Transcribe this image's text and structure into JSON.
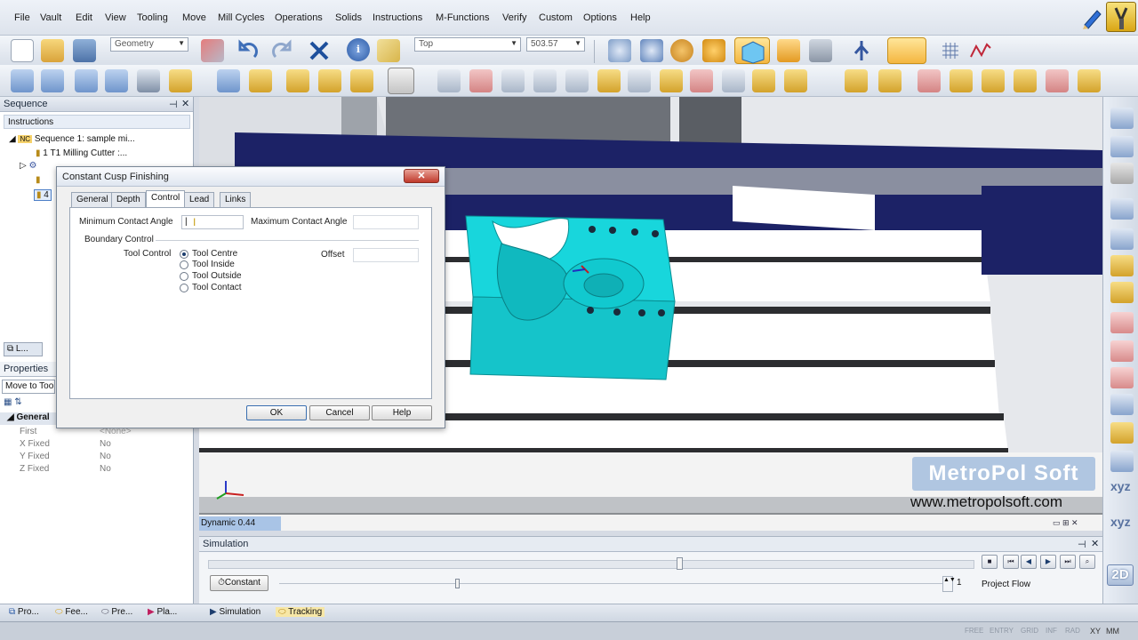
{
  "menu": [
    "File",
    "Vault",
    "Edit",
    "View",
    "Tooling",
    "Move",
    "Mill Cycles",
    "Operations",
    "Solids",
    "Instructions",
    "M-Functions",
    "Verify",
    "Custom",
    "Options",
    "Help"
  ],
  "toolbar": {
    "view_combo": "Geometry",
    "orient_combo": "Top",
    "zoom_value": "503.57"
  },
  "sequence_panel": {
    "title": "Sequence",
    "root": "Instructions",
    "seq_label": "Sequence 1: sample mi...",
    "tool_item": "1 T1 Milling Cutter :...",
    "row3": "4",
    "tabs_label": "L..."
  },
  "properties_panel": {
    "title": "Properties",
    "dropdown": "Move to Too",
    "group": "General",
    "rows": [
      {
        "name": "First",
        "value": "<None>"
      },
      {
        "name": "X Fixed",
        "value": "No"
      },
      {
        "name": "Y Fixed",
        "value": "No"
      },
      {
        "name": "Z Fixed",
        "value": "No"
      }
    ]
  },
  "dialog": {
    "title": "Constant Cusp Finishing",
    "close": "✕",
    "tabs": [
      "General",
      "Depth",
      "Control",
      "Lead",
      "Links"
    ],
    "active_tab": "Control",
    "min_angle_label": "Minimum Contact Angle",
    "max_angle_label": "Maximum Contact Angle",
    "boundary_label": "Boundary Control",
    "tool_control_label": "Tool Control",
    "offset_label": "Offset",
    "radios": [
      "Tool Centre",
      "Tool Inside",
      "Tool Outside",
      "Tool Contact"
    ],
    "selected_radio": "Tool Centre",
    "ok": "OK",
    "cancel": "Cancel",
    "help": "Help"
  },
  "viewport": {
    "status": "Dynamic 0.44",
    "brand": "MetroPol Soft",
    "url": "www.metropolsoft.com"
  },
  "simulation": {
    "title": "Simulation",
    "mode_button": "Constant",
    "step_value": "1",
    "project_flow": "Project Flow",
    "tabs": [
      "Simulation",
      "Tracking"
    ]
  },
  "bottom_tabs": [
    "Pro...",
    "Fee...",
    "Pre...",
    "Pla..."
  ],
  "status": {
    "items": [
      "FREE",
      "ENTRY",
      "GRID",
      "INF",
      "RAD",
      "XY",
      "MM"
    ]
  },
  "rightbar": {
    "xyz1": "xyz",
    "xyz2": "xyz",
    "btn2d": "2D"
  },
  "colors": {
    "part": "#14d6dc",
    "accent": "#1c3d6e",
    "dark_blue": "#1c2266"
  }
}
